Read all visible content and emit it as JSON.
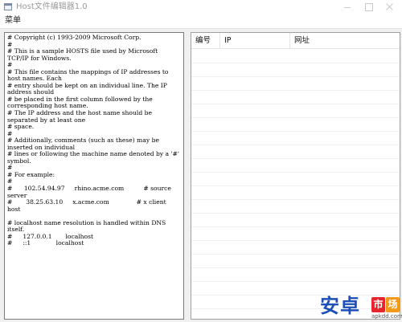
{
  "window": {
    "title": "Host文件编辑器1.0"
  },
  "menu": {
    "items": [
      {
        "label": "菜单"
      }
    ]
  },
  "editor": {
    "content": "# Copyright (c) 1993-2009 Microsoft Corp.\n#\n# This is a sample HOSTS file used by Microsoft TCP/IP for Windows.\n#\n# This file contains the mappings of IP addresses to host names. Each\n# entry should be kept on an individual line. The IP address should\n# be placed in the first column followed by the corresponding host name.\n# The IP address and the host name should be separated by at least one\n# space.\n#\n# Additionally, comments (such as these) may be inserted on individual\n# lines or following the machine name denoted by a '#' symbol.\n#\n# For example:\n#\n#      102.54.94.97     rhino.acme.com          # source server\n#       38.25.63.10     x.acme.com              # x client host\n\n# localhost name resolution is handled within DNS itself.\n#\t127.0.0.1       localhost\n#\t::1             localhost"
  },
  "table": {
    "columns": [
      {
        "label": "编号"
      },
      {
        "label": "IP"
      },
      {
        "label": "网址"
      }
    ],
    "rows": []
  },
  "watermark": {
    "main": "安卓",
    "badge": [
      "市",
      "场"
    ],
    "sub": "apkdd.com"
  }
}
